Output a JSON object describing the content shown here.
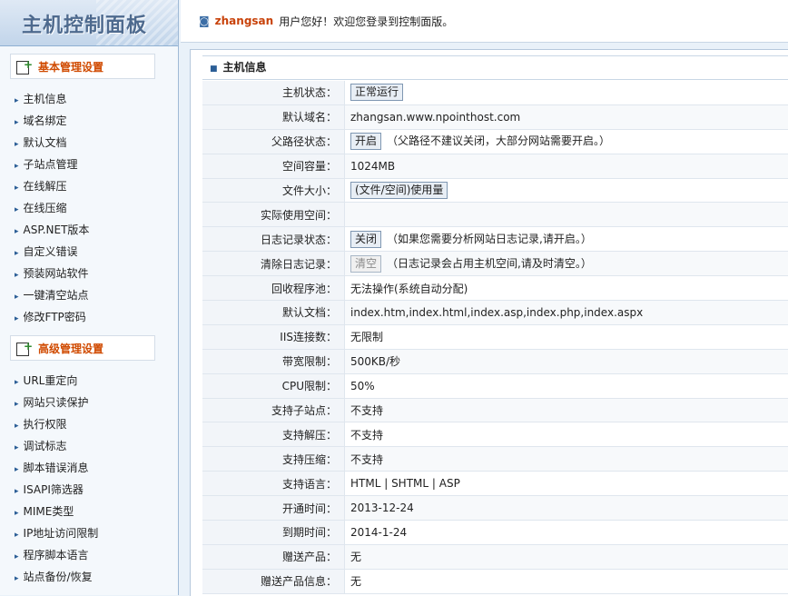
{
  "sidebar": {
    "title": "主机控制面板",
    "section1": {
      "title": "基本管理设置",
      "items": [
        "主机信息",
        "域名绑定",
        "默认文档",
        "子站点管理",
        "在线解压",
        "在线压缩",
        "ASP.NET版本",
        "自定义错误",
        "预装网站软件",
        "一键清空站点",
        "修改FTP密码"
      ]
    },
    "section2": {
      "title": "高级管理设置",
      "items": [
        "URL重定向",
        "网站只读保护",
        "执行权限",
        "调试标志",
        "脚本错误消息",
        "ISAPI筛选器",
        "MIME类型",
        "IP地址访问限制",
        "程序脚本语言",
        "站点备份/恢复"
      ]
    }
  },
  "header": {
    "username": "zhangsan",
    "welcome": "用户您好！欢迎您登录到控制面版。"
  },
  "panel": {
    "title": "主机信息"
  },
  "info": {
    "status_label": "主机状态：",
    "status_btn": "正常运行",
    "domain_label": "默认域名：",
    "domain": "zhangsan.www.npointhost.com",
    "parent_label": "父路径状态：",
    "parent_btn": "开启",
    "parent_note": "（父路径不建议关闭，大部分网站需要开启。）",
    "space_label": "空间容量：",
    "space": "1024MB",
    "filesize_label": "文件大小：",
    "filesize_btn": "(文件/空间)使用量",
    "used_label": "实际使用空间：",
    "used": "",
    "log_label": "日志记录状态：",
    "log_btn": "关闭",
    "log_note": "（如果您需要分析网站日志记录,请开启。）",
    "clearlog_label": "清除日志记录：",
    "clearlog_btn": "清空",
    "clearlog_note": "（日志记录会占用主机空间,请及时清空。）",
    "pool_label": "回收程序池：",
    "pool": "无法操作(系统自动分配)",
    "doc_label": "默认文档：",
    "doc": "index.htm,index.html,index.asp,index.php,index.aspx",
    "iis_label": "IIS连接数：",
    "iis": "无限制",
    "bw_label": "带宽限制：",
    "bw": "500KB/秒",
    "cpu_label": "CPU限制：",
    "cpu": "50%",
    "sub_label": "支持子站点：",
    "sub": "不支持",
    "unzip_label": "支持解压：",
    "unzip": "不支持",
    "zip_label": "支持压缩：",
    "zip": "不支持",
    "lang_label": "支持语言：",
    "lang": "HTML | SHTML | ASP",
    "open_label": "开通时间：",
    "open": "2013-12-24",
    "expire_label": "到期时间：",
    "expire": "2014-1-24",
    "gift_label": "赠送产品：",
    "gift": "无",
    "giftinfo_label": "赠送产品信息：",
    "giftinfo": "无"
  }
}
